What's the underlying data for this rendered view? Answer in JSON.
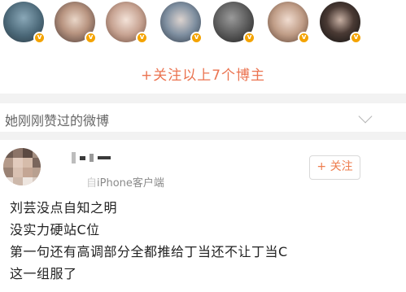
{
  "recommend": {
    "avatars": [
      {
        "name": "blogger-1",
        "badge": "v"
      },
      {
        "name": "blogger-2",
        "badge": "v"
      },
      {
        "name": "blogger-3",
        "badge": "v"
      },
      {
        "name": "blogger-4",
        "badge": "v"
      },
      {
        "name": "blogger-5",
        "badge": "v"
      },
      {
        "name": "blogger-6",
        "badge": "v"
      },
      {
        "name": "blogger-7",
        "badge": "v"
      }
    ],
    "follow_all_label": "+关注以上7个博主"
  },
  "section": {
    "title": "她刚刚赞过的微博"
  },
  "post": {
    "source_prefix": "自",
    "source_client": "iPhone客户端",
    "follow_label": "+ 关注",
    "lines": [
      "刘芸没点自知之明",
      "没实力硬站C位",
      "第一句还有高调部分全都推给丁当还不让丁当C",
      "这一组服了"
    ]
  },
  "colors": {
    "accent": "#eb7350",
    "badge": "#f4a300",
    "separator": "#f2f2f2"
  }
}
